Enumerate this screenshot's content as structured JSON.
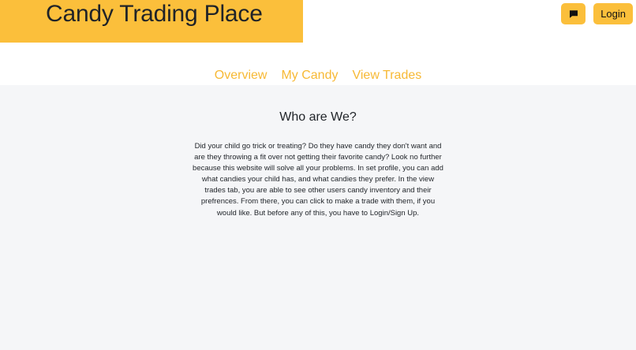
{
  "header": {
    "site_title": "Candy Trading Place",
    "chat_icon": "chat-bubble-icon",
    "login_label": "Login"
  },
  "nav": {
    "items": [
      "Overview",
      "My Candy",
      "View Trades"
    ]
  },
  "main": {
    "heading": "Who are We?",
    "body": "Did your child go trick or treating? Do they have candy they don't want and are they throwing a fit over not getting their favorite candy? Look no further because this website will solve all your problems. In set profile, you can add what candies your child has, and what candies they prefer. In the view trades tab, you are able to see other users candy inventory and their prefrences. From there, you can click to make a trade with them, if you would like. But before any of this, you have to Login/Sign Up."
  },
  "colors": {
    "accent": "#fbbf3b",
    "nav_link": "#f7b935",
    "content_background": "#f5f6f8"
  }
}
